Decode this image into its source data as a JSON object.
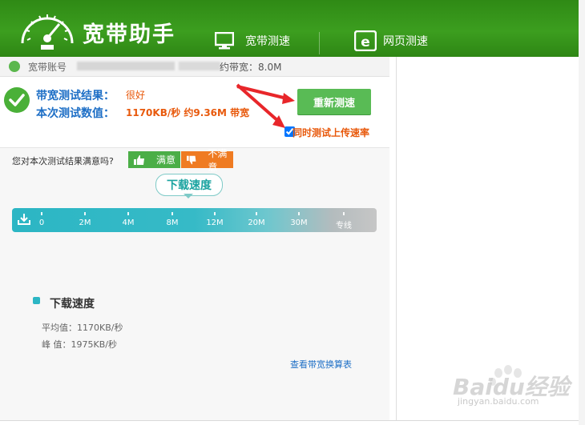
{
  "app": {
    "title": "宽带助手"
  },
  "tabs": [
    {
      "label": "宽带测速",
      "icon": "monitor-icon"
    },
    {
      "label": "网页测速",
      "icon": "ie-browser-icon"
    }
  ],
  "account": {
    "label": "宽带账号",
    "subscribed_bandwidth": "约带宽：8.0M"
  },
  "result": {
    "label": "带宽测试结果：",
    "value": "很好",
    "measure_label": "本次测试数值：",
    "measure_value": "1170KB/秒 约9.36M 带宽"
  },
  "actions": {
    "retest": "重新测速",
    "upload_checkbox_label": "同时测试上传速率",
    "upload_checked": true
  },
  "feedback": {
    "question": "您对本次测试结果满意吗?",
    "satisfied": "满意",
    "unsatisfied": "不满意"
  },
  "speed": {
    "bubble": "下载速度",
    "scale": [
      "0",
      "2M",
      "4M",
      "8M",
      "12M",
      "20M",
      "30M",
      "专线"
    ],
    "bar_color": "#2cb6c4"
  },
  "stats": {
    "title": "下载速度",
    "average": "平均值：1170KB/秒",
    "peak": "峰 值：1975KB/秒"
  },
  "links": {
    "conversion_table": "查看带宽换算表"
  },
  "watermark": {
    "text": "Baidu经验",
    "sub": "jingyan.baidu.com"
  },
  "colors": {
    "header_green": "#3c9e1f",
    "accent_orange": "#e8590c",
    "link_blue": "#1e6fc6",
    "button_green": "#59bb55"
  }
}
